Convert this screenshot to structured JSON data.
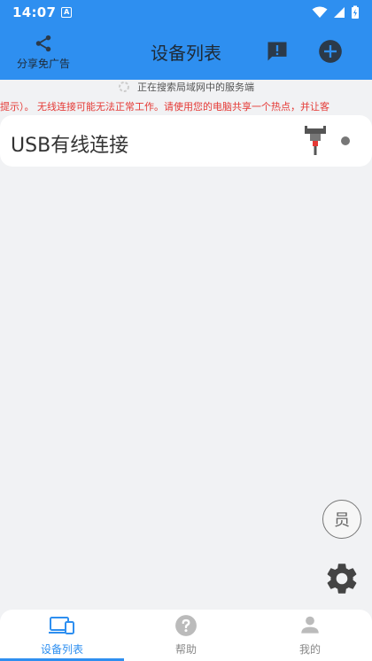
{
  "status_bar": {
    "time": "14:07",
    "notification_badge": "A",
    "icons": [
      "wifi-icon",
      "signal-icon",
      "battery-charging-icon"
    ]
  },
  "app_bar": {
    "share_label": "分享免广告",
    "title": "设备列表",
    "actions": [
      "feedback-icon",
      "add-circle-icon"
    ]
  },
  "search_status": "正在搜索局域网中的服务端",
  "notice": "提示）。 无线连接可能无法正常工作。请使用您的电脑共享一个热点，并让客",
  "devices": [
    {
      "name": "USB有线连接",
      "icon": "usb-cable-icon",
      "status": "offline"
    }
  ],
  "floating": {
    "vip_label": "员",
    "settings_icon": "gear-icon"
  },
  "tabs": [
    {
      "label": "设备列表",
      "icon": "devices-icon",
      "active": true
    },
    {
      "label": "帮助",
      "icon": "help-icon",
      "active": false
    },
    {
      "label": "我的",
      "icon": "person-icon",
      "active": false
    }
  ],
  "colors": {
    "primary": "#2e8ff0",
    "notice_red": "#e53935",
    "background": "#f1f2f4"
  }
}
